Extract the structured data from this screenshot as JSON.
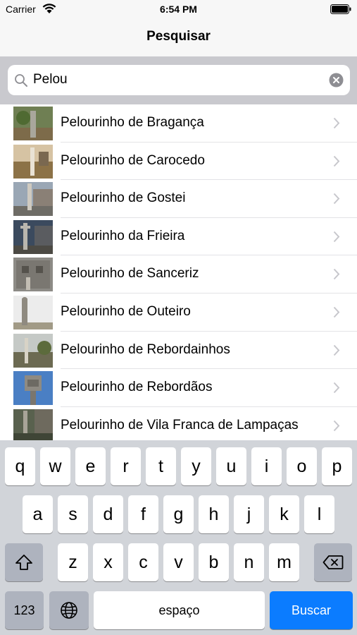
{
  "status_bar": {
    "carrier": "Carrier",
    "time": "6:54 PM"
  },
  "nav": {
    "title": "Pesquisar"
  },
  "search": {
    "value": "Pelou",
    "placeholder": ""
  },
  "results": [
    {
      "label": "Pelourinho de Bragança"
    },
    {
      "label": "Pelourinho de Carocedo"
    },
    {
      "label": "Pelourinho de Gostei"
    },
    {
      "label": "Pelourinho da Frieira"
    },
    {
      "label": "Pelourinho de Sanceriz"
    },
    {
      "label": "Pelourinho de Outeiro"
    },
    {
      "label": "Pelourinho de Rebordainhos"
    },
    {
      "label": "Pelourinho de Rebordãos"
    },
    {
      "label": "Pelourinho de Vila Franca de Lampaças"
    }
  ],
  "keyboard": {
    "row1": [
      "q",
      "w",
      "e",
      "r",
      "t",
      "y",
      "u",
      "i",
      "o",
      "p"
    ],
    "row2": [
      "a",
      "s",
      "d",
      "f",
      "g",
      "h",
      "j",
      "k",
      "l"
    ],
    "row3": [
      "z",
      "x",
      "c",
      "v",
      "b",
      "n",
      "m"
    ],
    "numbers_label": "123",
    "space_label": "espaço",
    "return_label": "Buscar"
  }
}
